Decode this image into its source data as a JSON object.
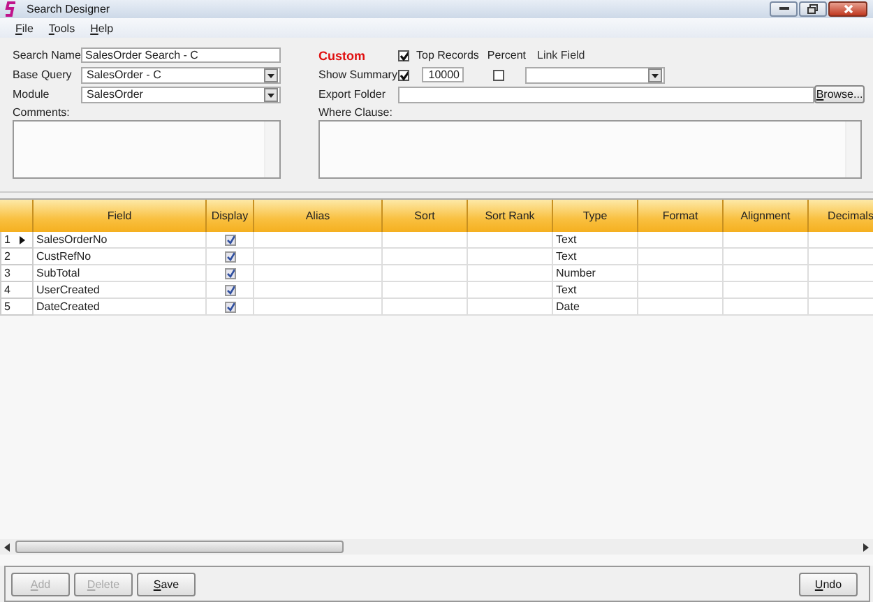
{
  "window": {
    "title": "Search Designer"
  },
  "menu": [
    {
      "label": "File"
    },
    {
      "label": "Tools"
    },
    {
      "label": "Help"
    }
  ],
  "form": {
    "search_name": {
      "label": "Search Name",
      "value": "SalesOrder Search - C"
    },
    "base_query": {
      "label": "Base Query",
      "value": "SalesOrder - C"
    },
    "module": {
      "label": "Module",
      "value": "SalesOrder"
    },
    "comments": {
      "label": "Comments:"
    },
    "custom": "Custom",
    "top_records": {
      "label": "Top Records",
      "checked": true
    },
    "show_summary": {
      "label": "Show Summary",
      "checked": true
    },
    "top_records_count": "10000",
    "percent": {
      "label": "Percent",
      "checked": false
    },
    "link_field": {
      "label": "Link Field"
    },
    "export_folder": {
      "label": "Export Folder",
      "button": "Browse..."
    },
    "where_clause": {
      "label": "Where Clause:"
    }
  },
  "table": {
    "columns": [
      "Field",
      "Display",
      "Alias",
      "Sort",
      "Sort Rank",
      "Type",
      "Format",
      "Alignment",
      "Decimals"
    ],
    "rows": [
      {
        "number": "1",
        "selected": true,
        "field": "SalesOrderNo",
        "display": true,
        "type": "Text"
      },
      {
        "number": "2",
        "selected": false,
        "field": "CustRefNo",
        "display": true,
        "type": "Text"
      },
      {
        "number": "3",
        "selected": false,
        "field": "SubTotal",
        "display": true,
        "type": "Number"
      },
      {
        "number": "4",
        "selected": false,
        "field": "UserCreated",
        "display": true,
        "type": "Text"
      },
      {
        "number": "5",
        "selected": false,
        "field": "DateCreated",
        "display": true,
        "type": "Date"
      }
    ]
  },
  "buttons": [
    {
      "label": "Add",
      "disabled": true
    },
    {
      "label": "Delete",
      "disabled": true
    },
    {
      "label": "Save",
      "disabled": false
    },
    {
      "label": "Undo",
      "disabled": false
    }
  ]
}
